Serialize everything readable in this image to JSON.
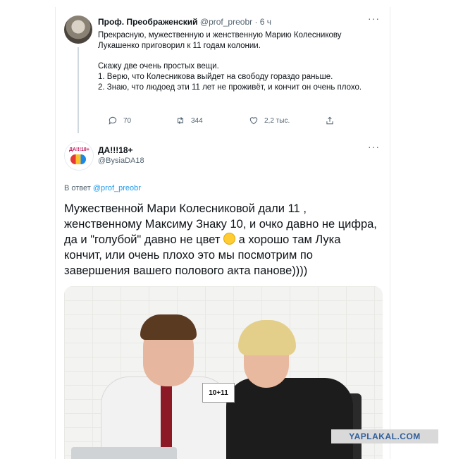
{
  "tweet1": {
    "name": "Проф. Преображенский",
    "handle": "@prof_preobr",
    "time": "· 6 ч",
    "more": "···",
    "body": [
      "Прекрасную, мужественную и женственную Марию Колесникову Лукашенко приговорил к 11 годам колонии.",
      "Скажу две очень простых вещи.\n1. Верю, что Колесникова выйдет на свободу гораздо раньше.\n2. Знаю, что людоед эти 11 лет не проживёт, и кончит он очень плохо."
    ],
    "replies": "70",
    "retweets": "344",
    "likes": "2,2 тыс."
  },
  "tweet2": {
    "name": "ДА!!!18+",
    "handle": "@BysiaDA18",
    "more": "···",
    "avatar_text": "ДА!!!18+",
    "reply_prefix": "В ответ",
    "reply_to": "@prof_preobr",
    "body_part1": "Мужественной Мари Колесниковой дали 11 , женственному Максиму Знаку 10, и очко давно не цифра, да и \"голубой\"  давно не цвет",
    "body_part2": " а хорошо там Лука кончит, или очень плохо это мы посмотрим по завершения вашего полового акта  панове))))",
    "photo_sign": "10+11"
  },
  "watermark": "YAPLAKAL.COM",
  "icons": {
    "reply": "reply-icon",
    "retweet": "retweet-icon",
    "like": "heart-icon",
    "share": "share-icon"
  }
}
